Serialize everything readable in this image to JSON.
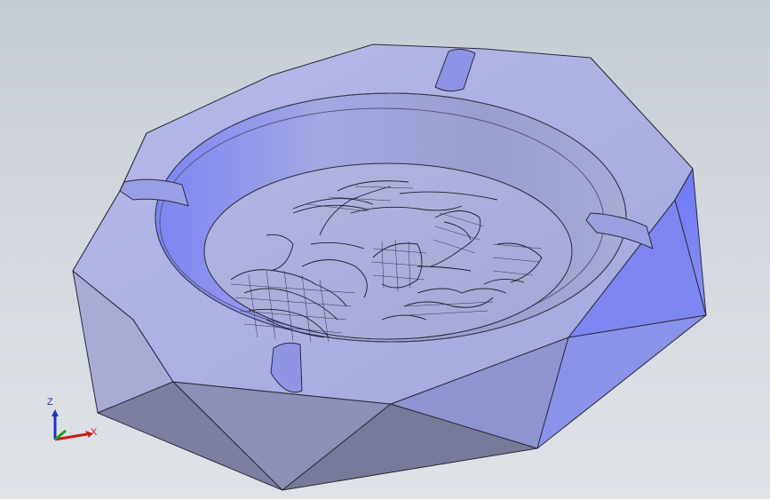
{
  "viewport": {
    "background_top": "#c6ccd4",
    "background_bottom": "#dfe3e8"
  },
  "model": {
    "name": "ashtray",
    "shape": "octagonal",
    "cigarette_rests": 4,
    "body_color": "#a9acde",
    "highlight_color": "#7a82f4",
    "edge_color": "#2a2a3a"
  },
  "triad": {
    "x_label": "X",
    "z_label": "Z",
    "x_color": "#d01818",
    "y_color": "#19a219",
    "z_color": "#1a33c8"
  }
}
